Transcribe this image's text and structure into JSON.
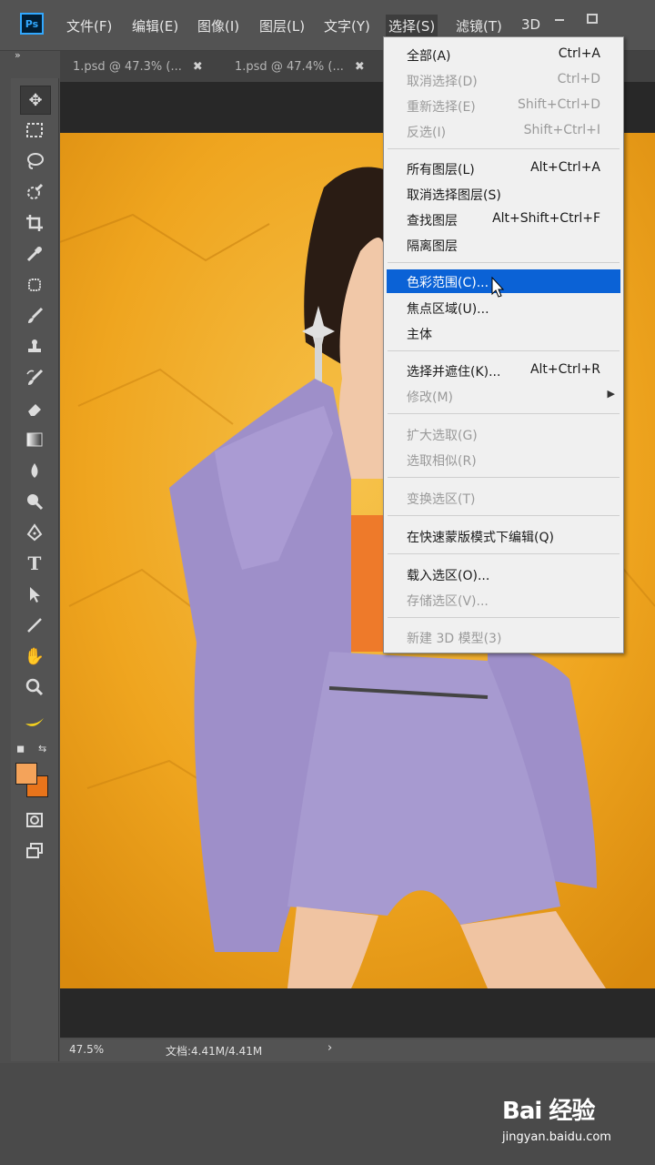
{
  "app": {
    "logo_text": "Ps",
    "menus": [
      "文件(F)",
      "编辑(E)",
      "图像(I)",
      "图层(L)",
      "文字(Y)",
      "选择(S)",
      "滤镜(T)",
      "3D"
    ],
    "active_menu": "选择(S)"
  },
  "tabs": [
    {
      "label": "1.psd @ 47.3% (...",
      "close": "✖"
    },
    {
      "label": "1.psd @ 47.4% (...",
      "close": "✖"
    }
  ],
  "tools": [
    "move-tool",
    "marquee-tool",
    "lasso-tool",
    "quick-selection-tool",
    "crop-tool",
    "eyedropper-tool",
    "healing-tool",
    "brush-tool",
    "stamp-tool",
    "history-brush-tool",
    "eraser-tool",
    "gradient-tool",
    "blur-tool",
    "dodge-tool",
    "pen-tool",
    "type-tool",
    "path-selection-tool",
    "line-tool",
    "hand-tool",
    "zoom-tool",
    "banana-icon"
  ],
  "colors": {
    "foreground": "#f4a35a",
    "background": "#e8741b",
    "highlight": "#0b62d6"
  },
  "select_menu": {
    "groups": [
      [
        {
          "label": "全部(A)",
          "shortcut": "Ctrl+A",
          "enabled": true
        },
        {
          "label": "取消选择(D)",
          "shortcut": "Ctrl+D",
          "enabled": false
        },
        {
          "label": "重新选择(E)",
          "shortcut": "Shift+Ctrl+D",
          "enabled": false
        },
        {
          "label": "反选(I)",
          "shortcut": "Shift+Ctrl+I",
          "enabled": false
        }
      ],
      [
        {
          "label": "所有图层(L)",
          "shortcut": "Alt+Ctrl+A",
          "enabled": true
        },
        {
          "label": "取消选择图层(S)",
          "shortcut": "",
          "enabled": true
        },
        {
          "label": "查找图层",
          "shortcut": "Alt+Shift+Ctrl+F",
          "enabled": true
        },
        {
          "label": "隔离图层",
          "shortcut": "",
          "enabled": true
        }
      ],
      [
        {
          "label": "色彩范围(C)...",
          "shortcut": "",
          "enabled": true,
          "highlighted": true
        },
        {
          "label": "焦点区域(U)...",
          "shortcut": "",
          "enabled": true
        },
        {
          "label": "主体",
          "shortcut": "",
          "enabled": true
        }
      ],
      [
        {
          "label": "选择并遮住(K)...",
          "shortcut": "Alt+Ctrl+R",
          "enabled": true
        },
        {
          "label": "修改(M)",
          "shortcut": "",
          "enabled": false,
          "submenu": true
        }
      ],
      [
        {
          "label": "扩大选取(G)",
          "shortcut": "",
          "enabled": false
        },
        {
          "label": "选取相似(R)",
          "shortcut": "",
          "enabled": false
        }
      ],
      [
        {
          "label": "变换选区(T)",
          "shortcut": "",
          "enabled": false
        }
      ],
      [
        {
          "label": "在快速蒙版模式下编辑(Q)",
          "shortcut": "",
          "enabled": true
        }
      ],
      [
        {
          "label": "载入选区(O)...",
          "shortcut": "",
          "enabled": true
        },
        {
          "label": "存储选区(V)...",
          "shortcut": "",
          "enabled": false
        }
      ],
      [
        {
          "label": "新建 3D 模型(3)",
          "shortcut": "",
          "enabled": false
        }
      ]
    ]
  },
  "status": {
    "zoom": "47.5%",
    "doc": "文档:4.41M/4.41M",
    "arrow": "›"
  },
  "watermark": {
    "main": "Bai 经验",
    "sub": "jingyan.baidu.com"
  }
}
